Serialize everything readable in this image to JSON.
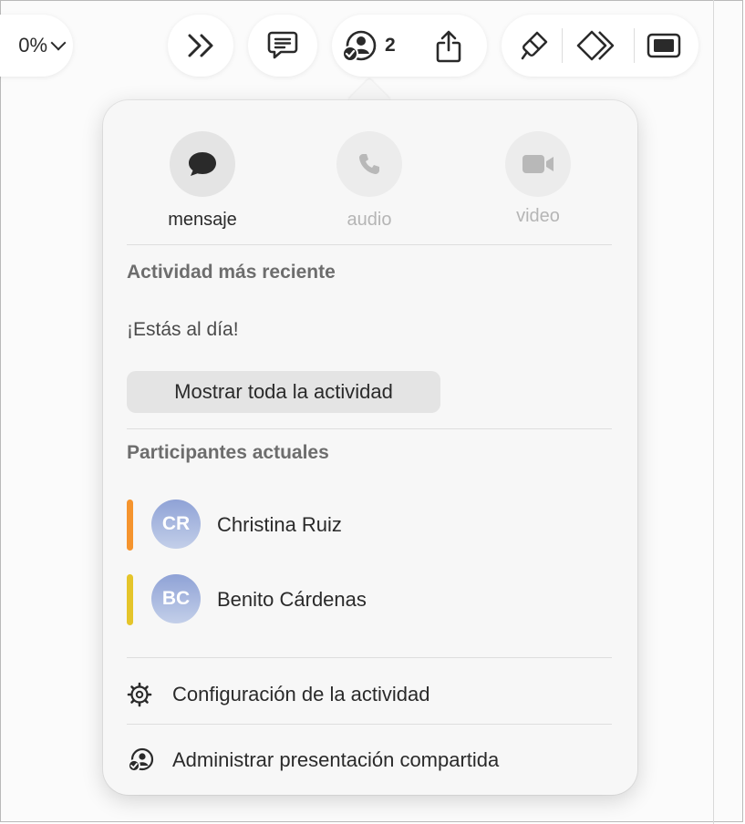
{
  "toolbar": {
    "zoom_value": "0%",
    "collaborator_count": "2",
    "icons": [
      "chevron-down-icon",
      "forward-double-chevron-icon",
      "comment-icon",
      "collaboration-icon",
      "share-icon",
      "format-brush-icon",
      "animate-icon",
      "play-icon"
    ]
  },
  "communication": {
    "message_label": "mensaje",
    "audio_label": "audio",
    "video_label": "video"
  },
  "activity": {
    "title": "Actividad más reciente",
    "status": "¡Estás al día!",
    "show_all_label": "Mostrar toda la actividad"
  },
  "participants": {
    "title": "Participantes actuales",
    "list": [
      {
        "initials": "CR",
        "name": "Christina Ruiz",
        "color": "#f5942e"
      },
      {
        "initials": "BC",
        "name": "Benito Cárdenas",
        "color": "#e5c52a"
      }
    ]
  },
  "menu": {
    "activity_settings_label": "Configuración de la actividad",
    "manage_shared_label": "Administrar presentación compartida"
  },
  "colors": {
    "popover_bg": "#f7f7f7",
    "secondary_text": "#6d6d6d",
    "disabled_text": "#b5b5b5"
  }
}
